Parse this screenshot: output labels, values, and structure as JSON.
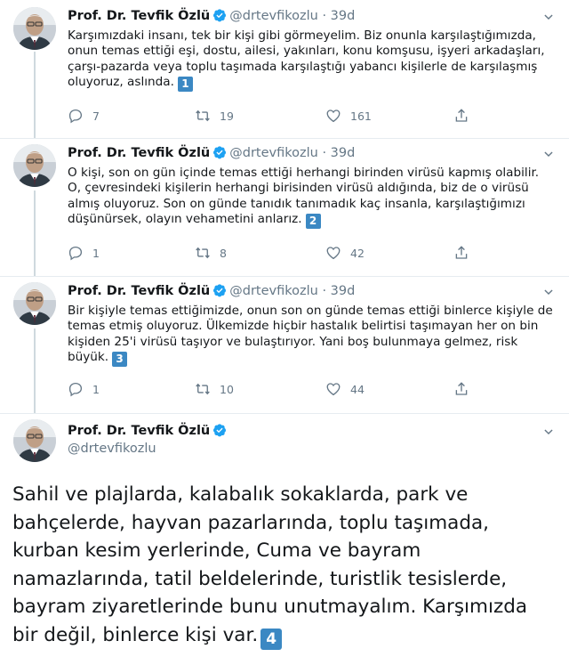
{
  "author": {
    "name": "Prof. Dr. Tevfik Özlü",
    "handle": "@drtevfikozlu",
    "dot": "·"
  },
  "colors": {
    "verified": "#1da1f2",
    "icon": "#657786",
    "badge": "#3b88c3",
    "separator": "#e6ecf0"
  },
  "tweets": [
    {
      "time": "39d",
      "text": "Karşımızdaki insanı, tek bir kişi gibi görmeyelim. Biz onunla karşılaştığımızda, onun temas ettiği eşi, dostu, ailesi, yakınları, konu komşusu, işyeri arkadaşları, çarşı-pazarda veya toplu taşımada karşılaştığı yabancı kişilerle de karşılaşmış oluyoruz, aslında.",
      "badge": "1",
      "replies": "7",
      "retweets": "19",
      "likes": "161"
    },
    {
      "time": "39d",
      "text": "O kişi, son on gün içinde temas ettiği herhangi birinden virüsü kapmış olabilir. O, çevresindeki kişilerin herhangi birisinden virüsü aldığında, biz de o virüsü almış oluyoruz. Son on günde tanıdık tanımadık kaç insanla, karşılaştığımızı düşünürsek, olayın vehametini anlarız.",
      "badge": "2",
      "replies": "1",
      "retweets": "8",
      "likes": "42"
    },
    {
      "time": "39d",
      "text": "Bir kişiyle temas ettiğimizde, onun son on günde temas ettiği binlerce kişiyle de temas etmiş oluyoruz. Ülkemizde hiçbir hastalık belirtisi taşımayan her on bin kişiden 25'i virüsü taşıyor ve bulaştırıyor. Yani boş bulunmaya gelmez, risk büyük.",
      "badge": "3",
      "replies": "1",
      "retweets": "10",
      "likes": "44"
    }
  ],
  "main_tweet": {
    "text": "Sahil ve plajlarda, kalabalık sokaklarda, park ve bahçelerde, hayvan pazarlarında, toplu taşımada, kurban kesim yerlerinde, Cuma ve bayram namazlarında, tatil beldelerinde, turistlik tesislerde, bayram ziyaretlerinde bunu unutmayalım. Karşımızda bir değil, binlerce kişi var.",
    "badge": "4"
  },
  "icons": {
    "reply": "reply-icon",
    "retweet": "retweet-icon",
    "like": "heart-icon",
    "share": "share-icon",
    "menu": "chevron-down-icon",
    "verified": "verified-badge-icon"
  }
}
